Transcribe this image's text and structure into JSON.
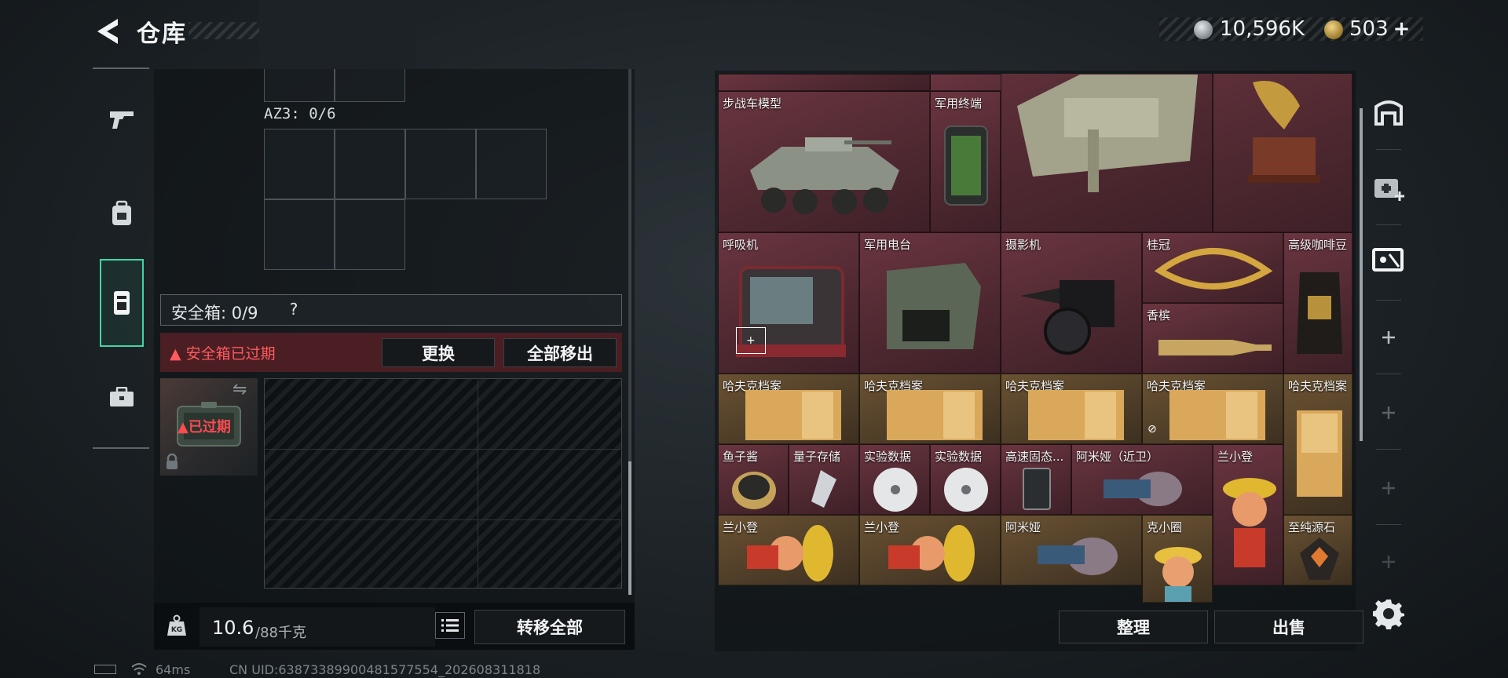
{
  "header": {
    "title": "仓库",
    "currency": {
      "silver": {
        "icon": "silver-coin-icon",
        "value": "10,596K"
      },
      "gold": {
        "icon": "gold-coin-icon",
        "value": "503",
        "add_label": "+"
      }
    }
  },
  "tabs": [
    {
      "icon": "pistol-icon"
    },
    {
      "icon": "backpack-icon"
    },
    {
      "icon": "safebox-icon",
      "active": true
    },
    {
      "icon": "toolbox-icon"
    }
  ],
  "left": {
    "az3_label": "AZ3: 0/6",
    "safebox": {
      "label": "安全箱: 0/9",
      "help": "?",
      "expired_notice": "安全箱已过期",
      "replace_label": "更换",
      "move_all_out_label": "全部移出",
      "item_status": "已过期"
    },
    "weight": {
      "current": "10.6",
      "max": "/88千克"
    },
    "transfer_all_label": "转移全部"
  },
  "right": {
    "items": [
      {
        "label": "步战车模型",
        "rarity": "red"
      },
      {
        "label": "军用终端",
        "rarity": "red"
      },
      {
        "label": "",
        "rarity": "red"
      },
      {
        "label": "",
        "rarity": "red"
      },
      {
        "label": "呼吸机",
        "rarity": "red"
      },
      {
        "label": "军用电台",
        "rarity": "red"
      },
      {
        "label": "摄影机",
        "rarity": "red"
      },
      {
        "label": "桂冠",
        "rarity": "red"
      },
      {
        "label": "香槟",
        "rarity": "red"
      },
      {
        "label": "高级咖啡豆",
        "rarity": "red"
      },
      {
        "label": "哈夫克档案",
        "rarity": "gold"
      },
      {
        "label": "哈夫克档案",
        "rarity": "gold"
      },
      {
        "label": "哈夫克档案",
        "rarity": "gold"
      },
      {
        "label": "哈夫克档案",
        "rarity": "gold"
      },
      {
        "label": "哈夫克档案",
        "rarity": "gold"
      },
      {
        "label": "鱼子酱",
        "rarity": "red"
      },
      {
        "label": "量子存储",
        "rarity": "red"
      },
      {
        "label": "实验数据",
        "rarity": "red"
      },
      {
        "label": "实验数据",
        "rarity": "red"
      },
      {
        "label": "高速固态...",
        "rarity": "red"
      },
      {
        "label": "阿米娅（近卫）",
        "rarity": "red"
      },
      {
        "label": "兰小登",
        "rarity": "red"
      },
      {
        "label": "兰小登",
        "rarity": "gold"
      },
      {
        "label": "兰小登",
        "rarity": "gold"
      },
      {
        "label": "阿米娅",
        "rarity": "gold"
      },
      {
        "label": "克小圈",
        "rarity": "gold"
      },
      {
        "label": "至纯源石",
        "rarity": "gold"
      }
    ],
    "tidy_label": "整理",
    "sell_label": "出售"
  },
  "footer": {
    "ping": "64ms",
    "uid": "CN UID:6387338990048157755​4_202608311818"
  },
  "colors": {
    "accent": "#3fd6a4",
    "danger": "#ff5a5f",
    "item_red": "#5a2e36",
    "item_gold": "#5a4530"
  }
}
